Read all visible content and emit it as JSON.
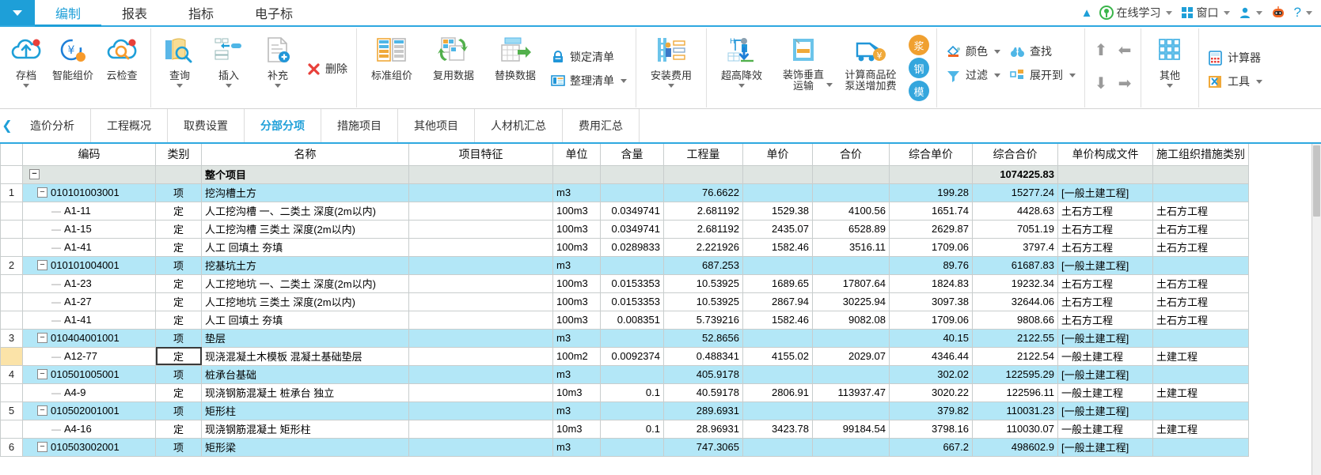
{
  "titlebar": {
    "app_menu_icon": "chevron-down-icon",
    "tabs": [
      {
        "label": "编制",
        "active": true
      },
      {
        "label": "报表",
        "active": false
      },
      {
        "label": "指标",
        "active": false
      },
      {
        "label": "电子标",
        "active": false
      }
    ],
    "right_items": [
      {
        "label": "在线学习",
        "icon": "online-study-icon",
        "caret": true
      },
      {
        "label": "窗口",
        "icon": "windows-grid-icon",
        "caret": true
      },
      {
        "label": "",
        "icon": "user-icon",
        "caret": true
      },
      {
        "label": "",
        "icon": "robot-icon",
        "caret": false
      },
      {
        "label": "?",
        "icon": "help-icon",
        "caret": true
      }
    ],
    "collapse_icon": "chevron-up-icon"
  },
  "ribbon": {
    "groups": [
      {
        "name": "file-group",
        "buttons": [
          {
            "label": "存档",
            "icon": "cloud-upload-icon",
            "caret": true
          },
          {
            "label": "智能组价",
            "icon": "smart-price-icon",
            "caret": false
          },
          {
            "label": "云检查",
            "icon": "cloud-check-icon",
            "caret": false
          }
        ]
      },
      {
        "name": "edit-group",
        "buttons": [
          {
            "label": "查询",
            "icon": "search-book-icon",
            "caret": true
          },
          {
            "label": "插入",
            "icon": "insert-row-icon",
            "caret": true
          },
          {
            "label": "补充",
            "icon": "add-document-icon",
            "caret": true
          }
        ],
        "small_buttons": [
          {
            "label": "删除",
            "icon": "delete-x-icon",
            "caret": false
          }
        ]
      },
      {
        "name": "data-group",
        "buttons": [
          {
            "label": "标准组价",
            "icon": "standard-price-icon",
            "caret": false
          },
          {
            "label": "复用数据",
            "icon": "reuse-data-icon",
            "caret": false
          },
          {
            "label": "替换数据",
            "icon": "replace-data-icon",
            "caret": false
          }
        ],
        "small_buttons": [
          {
            "label": "锁定清单",
            "icon": "lock-icon",
            "caret": false
          },
          {
            "label": "整理清单",
            "icon": "organize-list-icon",
            "caret": true
          }
        ]
      },
      {
        "name": "install-group",
        "buttons": [
          {
            "label": "安装费用",
            "icon": "install-cost-icon",
            "caret": true
          }
        ]
      },
      {
        "name": "construction-group",
        "buttons": [
          {
            "label": "超高降效",
            "icon": "height-efficiency-icon",
            "caret": true
          },
          {
            "label": "装饰垂直运输",
            "icon": "vertical-transport-icon",
            "caret": true
          },
          {
            "label": "计算商品砼泵送增加费",
            "icon": "concrete-pump-icon",
            "caret": false
          }
        ],
        "badges": [
          {
            "label": "浆",
            "color": "#f0a030"
          },
          {
            "label": "钢",
            "color": "#34a6dd"
          },
          {
            "label": "模",
            "color": "#34a6dd"
          }
        ]
      },
      {
        "name": "view-group",
        "small_buttons": [
          {
            "label": "颜色",
            "icon": "paint-bucket-icon",
            "caret": true
          },
          {
            "label": "查找",
            "icon": "binoculars-icon",
            "caret": false
          },
          {
            "label": "过滤",
            "icon": "filter-icon",
            "caret": true
          },
          {
            "label": "展开到",
            "icon": "expand-to-icon",
            "caret": true
          }
        ]
      },
      {
        "name": "move-group",
        "arrows": [
          "arrow-up-icon",
          "arrow-left-icon",
          "arrow-down-icon",
          "arrow-right-icon"
        ]
      },
      {
        "name": "other-group",
        "buttons": [
          {
            "label": "其他",
            "icon": "grid-apps-icon",
            "caret": true
          }
        ]
      },
      {
        "name": "tools-group",
        "small_buttons": [
          {
            "label": "计算器",
            "icon": "calculator-icon",
            "caret": false
          },
          {
            "label": "工具",
            "icon": "tools-icon",
            "caret": true
          }
        ]
      }
    ]
  },
  "subtabs": {
    "collapse_icon": "chevron-left-icon",
    "items": [
      {
        "label": "造价分析",
        "active": false
      },
      {
        "label": "工程概况",
        "active": false
      },
      {
        "label": "取费设置",
        "active": false
      },
      {
        "label": "分部分项",
        "active": true
      },
      {
        "label": "措施项目",
        "active": false
      },
      {
        "label": "其他项目",
        "active": false
      },
      {
        "label": "人材机汇总",
        "active": false
      },
      {
        "label": "费用汇总",
        "active": false
      }
    ]
  },
  "table": {
    "columns": [
      {
        "key": "rowno",
        "label": ""
      },
      {
        "key": "code",
        "label": "编码"
      },
      {
        "key": "cat",
        "label": "类别",
        "highlight": true
      },
      {
        "key": "name",
        "label": "名称"
      },
      {
        "key": "feat",
        "label": "项目特征"
      },
      {
        "key": "unit",
        "label": "单位"
      },
      {
        "key": "content",
        "label": "含量"
      },
      {
        "key": "qty",
        "label": "工程量"
      },
      {
        "key": "price",
        "label": "单价"
      },
      {
        "key": "sum",
        "label": "合价"
      },
      {
        "key": "cprice",
        "label": "综合单价"
      },
      {
        "key": "csum",
        "label": "综合合价"
      },
      {
        "key": "file",
        "label": "单价构成文件"
      },
      {
        "key": "org",
        "label": "施工组织措施类别"
      }
    ],
    "rows": [
      {
        "type": "total",
        "rowno": "",
        "level": 0,
        "expander": "minus",
        "code": "",
        "cat": "",
        "name": "整个项目",
        "feat": "",
        "unit": "",
        "content": "",
        "qty": "",
        "price": "",
        "sum": "",
        "cprice": "",
        "csum": "1074225.83",
        "file": "",
        "org": ""
      },
      {
        "type": "item",
        "rowno": "1",
        "level": 1,
        "expander": "minus",
        "code": "010101003001",
        "cat": "项",
        "name": "挖沟槽土方",
        "feat": "",
        "unit": "m3",
        "content": "",
        "qty": "76.6622",
        "price": "",
        "sum": "",
        "cprice": "199.28",
        "csum": "15277.24",
        "file": "[一般土建工程]",
        "org": ""
      },
      {
        "type": "norm",
        "rowno": "",
        "level": 2,
        "expander": "",
        "code": "A1-11",
        "cat": "定",
        "name": "人工挖沟槽 一、二类土 深度(2m以内)",
        "feat": "",
        "unit": "100m3",
        "content": "0.0349741",
        "qty": "2.681192",
        "price": "1529.38",
        "sum": "4100.56",
        "cprice": "1651.74",
        "csum": "4428.63",
        "file": "土石方工程",
        "org": "土石方工程"
      },
      {
        "type": "norm",
        "rowno": "",
        "level": 2,
        "expander": "",
        "code": "A1-15",
        "cat": "定",
        "name": "人工挖沟槽 三类土 深度(2m以内)",
        "feat": "",
        "unit": "100m3",
        "content": "0.0349741",
        "qty": "2.681192",
        "price": "2435.07",
        "sum": "6528.89",
        "cprice": "2629.87",
        "csum": "7051.19",
        "file": "土石方工程",
        "org": "土石方工程"
      },
      {
        "type": "norm",
        "rowno": "",
        "level": 2,
        "expander": "",
        "code": "A1-41",
        "cat": "定",
        "name": "人工 回填土 夯填",
        "feat": "",
        "unit": "100m3",
        "content": "0.0289833",
        "qty": "2.221926",
        "price": "1582.46",
        "sum": "3516.11",
        "cprice": "1709.06",
        "csum": "3797.4",
        "file": "土石方工程",
        "org": "土石方工程"
      },
      {
        "type": "item",
        "rowno": "2",
        "level": 1,
        "expander": "minus",
        "code": "010101004001",
        "cat": "项",
        "name": "挖基坑土方",
        "feat": "",
        "unit": "m3",
        "content": "",
        "qty": "687.253",
        "price": "",
        "sum": "",
        "cprice": "89.76",
        "csum": "61687.83",
        "file": "[一般土建工程]",
        "org": ""
      },
      {
        "type": "norm",
        "rowno": "",
        "level": 2,
        "expander": "",
        "code": "A1-23",
        "cat": "定",
        "name": "人工挖地坑 一、二类土 深度(2m以内)",
        "feat": "",
        "unit": "100m3",
        "content": "0.0153353",
        "qty": "10.53925",
        "price": "1689.65",
        "sum": "17807.64",
        "cprice": "1824.83",
        "csum": "19232.34",
        "file": "土石方工程",
        "org": "土石方工程"
      },
      {
        "type": "norm",
        "rowno": "",
        "level": 2,
        "expander": "",
        "code": "A1-27",
        "cat": "定",
        "name": "人工挖地坑 三类土 深度(2m以内)",
        "feat": "",
        "unit": "100m3",
        "content": "0.0153353",
        "qty": "10.53925",
        "price": "2867.94",
        "sum": "30225.94",
        "cprice": "3097.38",
        "csum": "32644.06",
        "file": "土石方工程",
        "org": "土石方工程"
      },
      {
        "type": "norm",
        "rowno": "",
        "level": 2,
        "expander": "",
        "code": "A1-41",
        "cat": "定",
        "name": "人工 回填土 夯填",
        "feat": "",
        "unit": "100m3",
        "content": "0.008351",
        "qty": "5.739216",
        "price": "1582.46",
        "sum": "9082.08",
        "cprice": "1709.06",
        "csum": "9808.66",
        "file": "土石方工程",
        "org": "土石方工程"
      },
      {
        "type": "item",
        "rowno": "3",
        "level": 1,
        "expander": "minus",
        "code": "010404001001",
        "cat": "项",
        "name": "垫层",
        "feat": "",
        "unit": "m3",
        "content": "",
        "qty": "52.8656",
        "price": "",
        "sum": "",
        "cprice": "40.15",
        "csum": "2122.55",
        "file": "[一般土建工程]",
        "org": ""
      },
      {
        "type": "norm",
        "rowno": "",
        "rowno_selected": true,
        "cat_selected": true,
        "level": 2,
        "expander": "",
        "code": "A12-77",
        "cat": "定",
        "name": "现浇混凝土木模板 混凝土基础垫层",
        "feat": "",
        "unit": "100m2",
        "content": "0.0092374",
        "qty": "0.488341",
        "price": "4155.02",
        "sum": "2029.07",
        "cprice": "4346.44",
        "csum": "2122.54",
        "file": "一般土建工程",
        "org": "土建工程"
      },
      {
        "type": "item",
        "rowno": "4",
        "level": 1,
        "expander": "minus",
        "code": "010501005001",
        "cat": "项",
        "name": "桩承台基础",
        "feat": "",
        "unit": "m3",
        "content": "",
        "qty": "405.9178",
        "price": "",
        "sum": "",
        "cprice": "302.02",
        "csum": "122595.29",
        "file": "[一般土建工程]",
        "org": ""
      },
      {
        "type": "norm",
        "rowno": "",
        "level": 2,
        "expander": "",
        "code": "A4-9",
        "cat": "定",
        "name": "现浇钢筋混凝土 桩承台 独立",
        "feat": "",
        "unit": "10m3",
        "content": "0.1",
        "qty": "40.59178",
        "price": "2806.91",
        "sum": "113937.47",
        "cprice": "3020.22",
        "csum": "122596.11",
        "file": "一般土建工程",
        "org": "土建工程"
      },
      {
        "type": "item",
        "rowno": "5",
        "level": 1,
        "expander": "minus",
        "code": "010502001001",
        "cat": "项",
        "name": "矩形柱",
        "feat": "",
        "unit": "m3",
        "content": "",
        "qty": "289.6931",
        "price": "",
        "sum": "",
        "cprice": "379.82",
        "csum": "110031.23",
        "file": "[一般土建工程]",
        "org": ""
      },
      {
        "type": "norm",
        "rowno": "",
        "level": 2,
        "expander": "",
        "code": "A4-16",
        "cat": "定",
        "name": "现浇钢筋混凝土 矩形柱",
        "feat": "",
        "unit": "10m3",
        "content": "0.1",
        "qty": "28.96931",
        "price": "3423.78",
        "sum": "99184.54",
        "cprice": "3798.16",
        "csum": "110030.07",
        "file": "一般土建工程",
        "org": "土建工程"
      },
      {
        "type": "item",
        "rowno": "6",
        "level": 1,
        "expander": "minus",
        "code": "010503002001",
        "cat": "项",
        "name": "矩形梁",
        "feat": "",
        "unit": "m3",
        "content": "",
        "qty": "747.3065",
        "price": "",
        "sum": "",
        "cprice": "667.2",
        "csum": "498602.9",
        "file": "[一般土建工程]",
        "org": ""
      }
    ]
  },
  "colors": {
    "accent": "#1e9fd8",
    "item_row": "#b3e7f7",
    "total_row": "#dfe5e2",
    "category_header": "#fbe3a8"
  }
}
